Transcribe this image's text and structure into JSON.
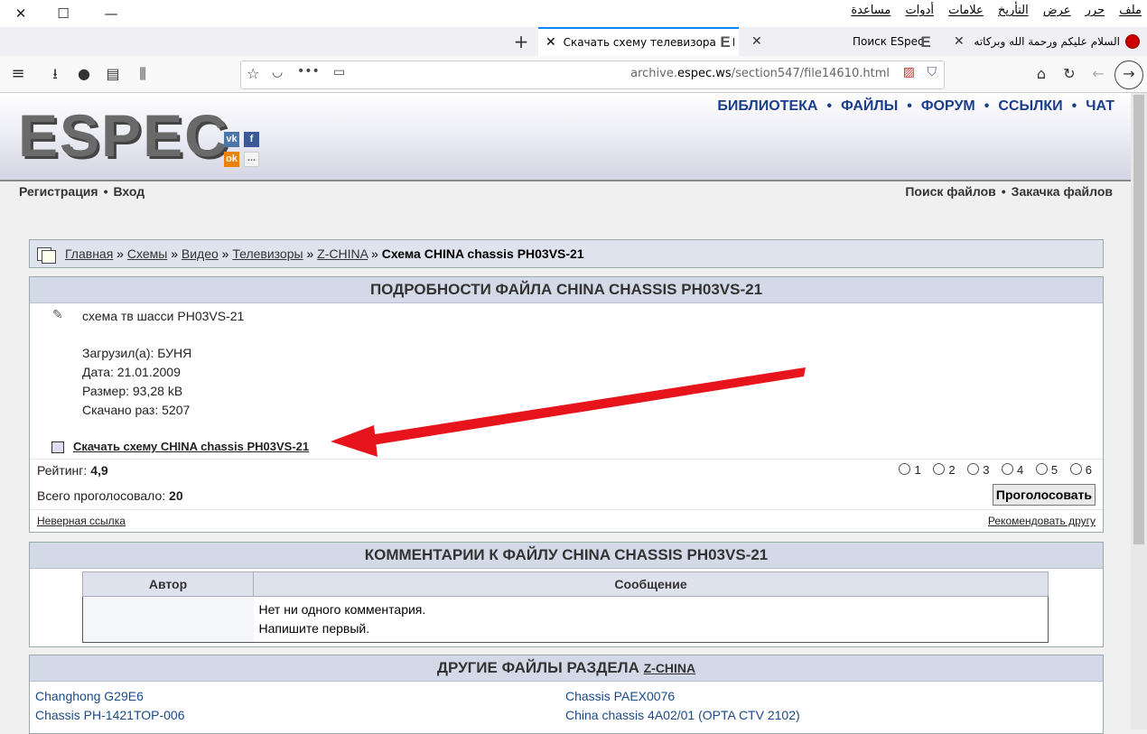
{
  "window": {
    "menu": [
      "ملف",
      "حرر",
      "عرض",
      "التأريخ",
      "علامات",
      "أدوات",
      "مساعدة"
    ]
  },
  "tabs": [
    {
      "label": "Скачать схему телевизора CH",
      "active": true
    },
    {
      "label": "Поиск ESpec",
      "active": false
    },
    {
      "label": "السلام عليكم ورحمة الله وبركاته و",
      "active": false
    }
  ],
  "toolbar": {
    "url_prefix": "archive.",
    "url_domain": "espec.ws",
    "url_path": "/section547/file14610.html"
  },
  "site": {
    "logo": "ESPEC",
    "social": {
      "vk": "vk",
      "fb": "f",
      "ok": "ok",
      "more": "..."
    },
    "nav": [
      "БИБЛИОТЕКА",
      "ФАЙЛЫ",
      "ФОРУМ",
      "ССЫЛКИ",
      "ЧАТ"
    ],
    "sub_left": [
      "Регистрация",
      "Вход"
    ],
    "sub_right": [
      "Поиск файлов",
      "Закачка файлов"
    ]
  },
  "breadcrumb": {
    "items": [
      "Главная",
      "Схемы",
      "Видео",
      "Телевизоры",
      "Z-CHINA"
    ],
    "current": "Схема CHINA chassis PH03VS-21"
  },
  "details": {
    "title": "ПОДРОБНОСТИ ФАЙЛА CHINA CHASSIS PH03VS-21",
    "description": "схема тв шасси PH03VS-21",
    "uploader": "Загрузил(а): БУНЯ",
    "date": "Дата: 21.01.2009",
    "size": "Размер: 93,28 kB",
    "downloads": "Скачано раз: 5207",
    "download_link": "Скачать схему CHINA chassis PH03VS-21",
    "rating_label": "Рейтинг:",
    "rating_value": "4,9",
    "votes_label": "Всего проголосовало:",
    "votes_value": "20",
    "rating_options": [
      "1",
      "2",
      "3",
      "4",
      "5",
      "6"
    ],
    "vote_button": "Проголосовать",
    "bad_link": "Неверная ссылка",
    "recommend": "Рекомендовать другу"
  },
  "comments": {
    "title": "КОММЕНТАРИИ К ФАЙЛУ CHINA CHASSIS PH03VS-21",
    "col_author": "Автор",
    "col_message": "Сообщение",
    "empty_line1": "Нет ни одного комментария.",
    "empty_line2": "Напишите первый."
  },
  "other": {
    "title_prefix": "ДРУГИЕ ФАЙЛЫ РАЗДЕЛА",
    "title_link": "Z-CHINA",
    "left": [
      "Changhong G29E6",
      "Chassis PH-1421TOP-006"
    ],
    "right": [
      "Chassis PAEX0076",
      "China chassis 4A02/01 (OPTA CTV 2102)"
    ]
  },
  "colors": {
    "nav": "#1a3e8c",
    "link": "#1a4a8a",
    "arrow": "#e8141c"
  }
}
